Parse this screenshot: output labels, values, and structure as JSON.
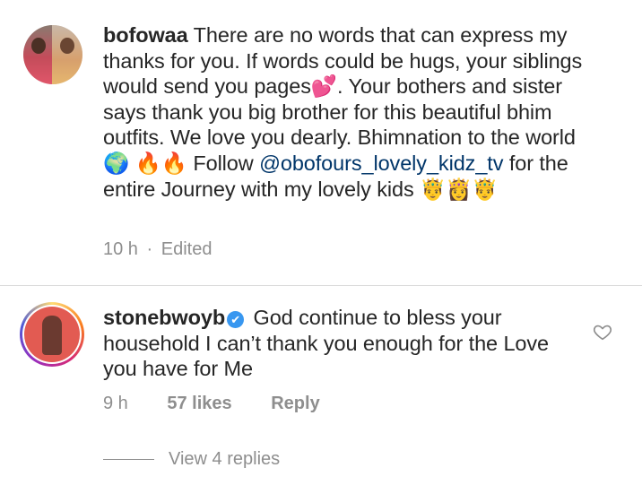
{
  "comments": [
    {
      "username": "bofowaa",
      "avatar_icon": "couple-photo-avatar",
      "text_before_mention": "There are no words that can express my thanks for you. If words could be hugs, your siblings would send you pages💕. Your bothers and sister says thank you big brother for this beautiful bhim outfits. We love you dearly. Bhimnation to the world 🌍 🔥🔥 Follow",
      "mention": "@obofours_lovely_kidz_tv",
      "text_after_mention": "for the entire Journey with my lovely kids 🤴👸🤴",
      "time": "10 h",
      "separator": "·",
      "edited": "Edited"
    },
    {
      "username": "stonebwoyb",
      "verified": true,
      "verified_icon": "✔",
      "avatar_icon": "man-red-background-avatar",
      "text": "God continue to bless your household I can’t thank you enough for the Love you have for Me",
      "time": "9 h",
      "likes": "57 likes",
      "reply_label": "Reply",
      "view_replies": "View 4 replies",
      "like_icon": "heart-outline-icon"
    }
  ],
  "colors": {
    "text": "#262626",
    "meta": "#8e8e8e",
    "mention": "#003569",
    "verified": "#3897f0",
    "divider": "#dbdbdb"
  }
}
